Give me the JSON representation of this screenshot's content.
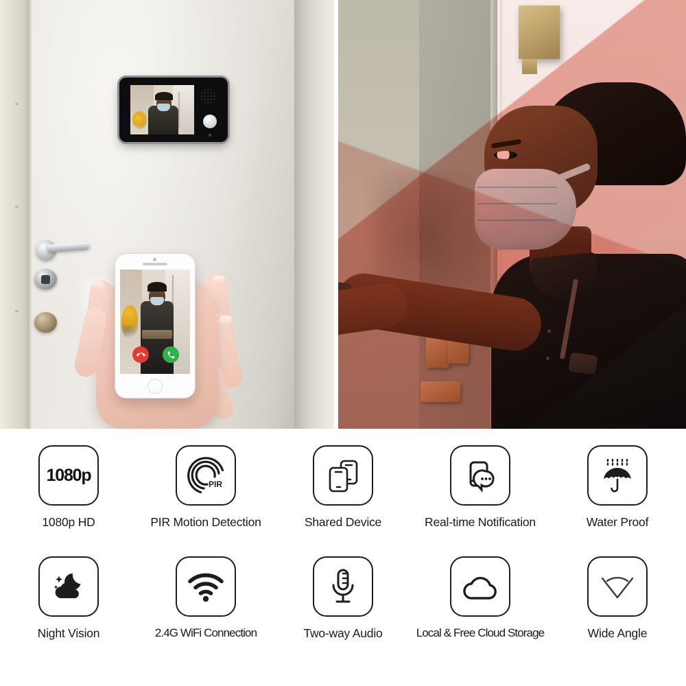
{
  "hero": {
    "left_photo": {
      "alt": "White entry door with indoor video intercom monitor and a hand holding a smartphone showing the video call",
      "monitor": {
        "name": "indoor-video-monitor",
        "visitor": "masked delivery person with flowers"
      },
      "phone_call": {
        "decline_label": "Decline",
        "accept_label": "Accept",
        "decline_color": "#e53935",
        "accept_color": "#2fb14a",
        "decline_icon": "phone-hangup-icon",
        "accept_icon": "phone-answer-icon"
      },
      "door_hardware": [
        "lever-handle",
        "lock-cylinder",
        "deadbolt-cylinder"
      ]
    },
    "right_photo": {
      "alt": "Woman wearing a face mask reaching toward a door fitted with a smart peephole camera, red PIR detection cone overlay",
      "device": {
        "name": "peephole-camera",
        "body_color": "#3b3e42",
        "lens_color": "#8e2a17"
      },
      "pir_cone_color": "#d6422a"
    }
  },
  "features": {
    "rows": [
      [
        {
          "icon": "resolution-1080p-icon",
          "icon_text": "1080p",
          "label": "1080p HD"
        },
        {
          "icon": "pir-sensor-icon",
          "icon_text": "PIR",
          "label": "PIR Motion Detection"
        },
        {
          "icon": "shared-device-icon",
          "label": "Shared Device"
        },
        {
          "icon": "notification-bubble-icon",
          "label": "Real-time Notification"
        },
        {
          "icon": "umbrella-waterproof-icon",
          "label": "Water Proof"
        }
      ],
      [
        {
          "icon": "night-vision-moon-cloud-icon",
          "label": "Night Vision"
        },
        {
          "icon": "wifi-icon",
          "label": "2.4G WiFi Connection"
        },
        {
          "icon": "microphone-icon",
          "label": "Two-way Audio"
        },
        {
          "icon": "cloud-storage-icon",
          "label": "Local & Free Cloud Storage"
        },
        {
          "icon": "wide-angle-icon",
          "label": "Wide Angle"
        }
      ]
    ]
  },
  "colors": {
    "icon_stroke": "#1d1d1f",
    "text": "#1a1a1a",
    "background": "#ffffff"
  }
}
